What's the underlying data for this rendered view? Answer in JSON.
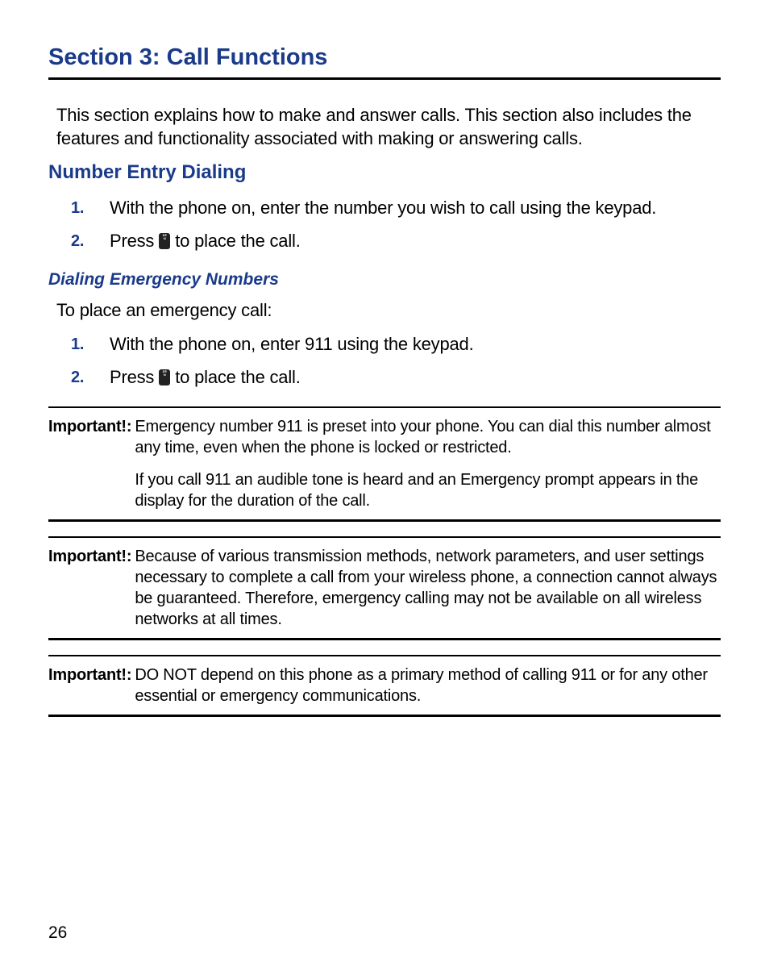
{
  "section_title": "Section 3: Call Functions",
  "intro": "This section explains how to make and answer calls. This section also includes the features and functionality associated with making or answering calls.",
  "h2_number_entry": "Number Entry Dialing",
  "steps1": {
    "s1": "With the phone on, enter the number you wish to call using the keypad.",
    "s2a": "Press ",
    "s2b": " to place the call."
  },
  "h3_emergency": "Dialing Emergency Numbers",
  "emergency_intro": "To place an emergency call:",
  "steps2": {
    "s1": "With the phone on, enter 911 using the keypad.",
    "s2a": "Press ",
    "s2b": " to place the call."
  },
  "important_label": "Important!:",
  "important1_p1": "Emergency number 911 is preset into your phone. You can dial this number almost any time, even when the phone is locked or restricted.",
  "important1_p2": "If you call 911 an audible tone is heard and an Emergency prompt appears in the display for the duration of the call.",
  "important2": "Because of various transmission methods, network parameters, and user settings necessary to complete a call from your wireless phone, a connection cannot always be guaranteed. Therefore, emergency calling may not be available on all wireless networks at all times.",
  "important3": "DO NOT depend on this phone as a primary method of calling 911 or for any other essential or emergency communications.",
  "page_number": "26",
  "num1": "1.",
  "num2": "2."
}
